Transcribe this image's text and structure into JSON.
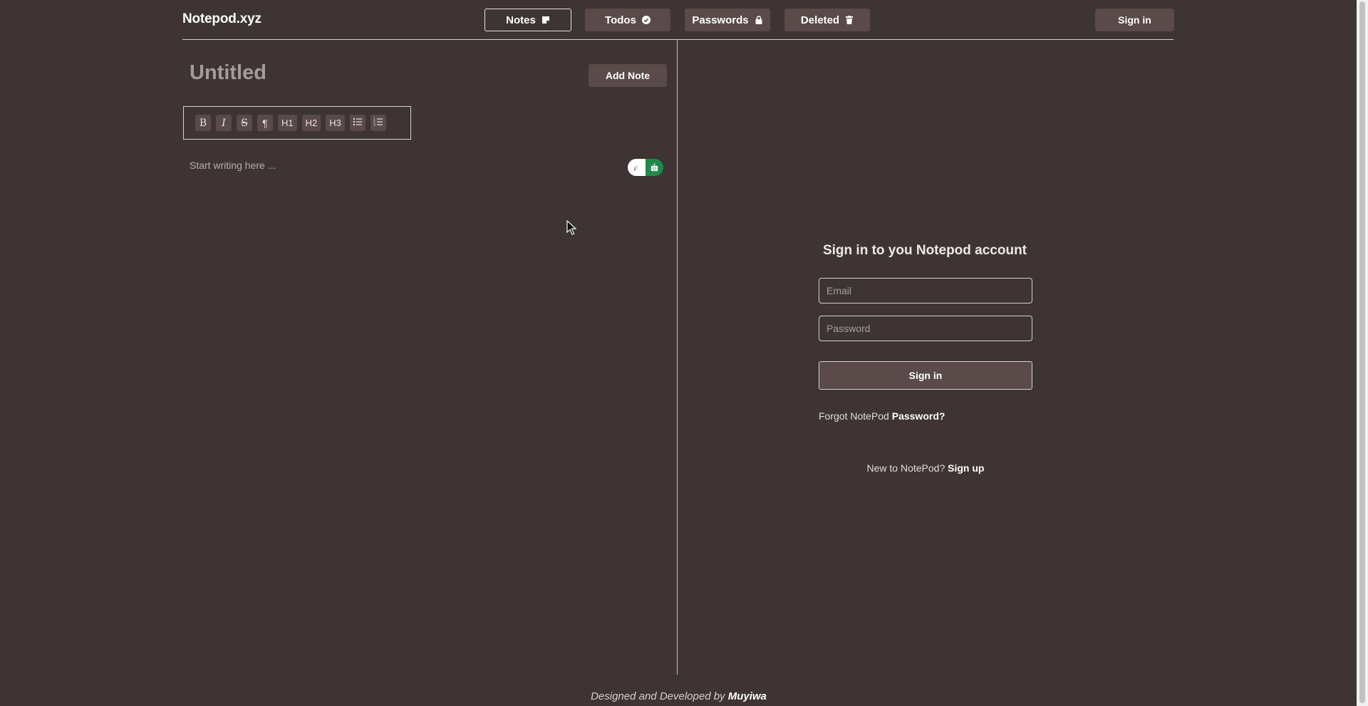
{
  "header": {
    "brand": "Notepod.xyz",
    "nav": [
      {
        "label": "Notes",
        "icon": "note-icon",
        "active": true
      },
      {
        "label": "Todos",
        "icon": "check-circle-icon",
        "active": false
      },
      {
        "label": "Passwords",
        "icon": "lock-icon",
        "active": false
      },
      {
        "label": "Deleted",
        "icon": "trash-icon",
        "active": false
      }
    ],
    "signin_label": "Sign in"
  },
  "editor": {
    "title_placeholder": "Untitled",
    "add_note_label": "Add Note",
    "toolbar": [
      {
        "label": "B",
        "name": "bold-button"
      },
      {
        "label": "I",
        "name": "italic-button"
      },
      {
        "label": "S",
        "name": "strikethrough-button"
      },
      {
        "label": "¶",
        "name": "paragraph-button"
      },
      {
        "label": "H1",
        "name": "heading1-button"
      },
      {
        "label": "H2",
        "name": "heading2-button"
      },
      {
        "label": "H3",
        "name": "heading3-button"
      },
      {
        "label": "",
        "name": "bullet-list-button",
        "icon": "bullet-list-icon"
      },
      {
        "label": "",
        "name": "ordered-list-button",
        "icon": "ordered-list-icon"
      }
    ],
    "body_placeholder": "Start writing here ..."
  },
  "signin": {
    "title": "Sign in to you Notepod account",
    "email_placeholder": "Email",
    "password_placeholder": "Password",
    "button_label": "Sign in",
    "forgot_prefix": "Forgot NotePod ",
    "forgot_link": "Password?",
    "new_prefix": "New to NotePod? ",
    "signup_link": "Sign up"
  },
  "footer": {
    "prefix": "Designed and Developed by ",
    "author": "Muyiwa"
  },
  "colors": {
    "background": "#3d3433",
    "button": "#5a4a4a",
    "toggle_green": "#1e8a4a"
  }
}
